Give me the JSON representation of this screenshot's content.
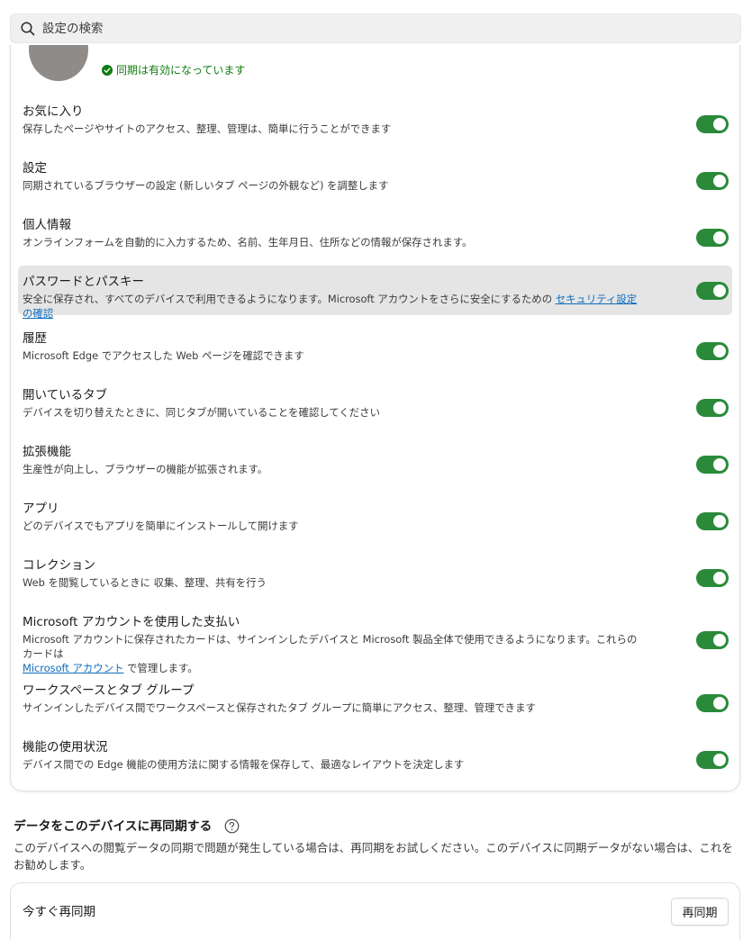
{
  "search": {
    "placeholder": "設定の検索"
  },
  "sync_status": {
    "text": "同期は有効になっています",
    "color": "#107c10"
  },
  "toggle_color": "#2a8a3a",
  "items": [
    {
      "title": "お気に入り",
      "desc": "保存したページやサイトのアクセス、整理、管理は、簡単に行うことができます",
      "enabled": true
    },
    {
      "title": "設定",
      "desc": "同期されているブラウザーの設定 (新しいタブ ページの外観など) を調整します",
      "enabled": true
    },
    {
      "title": "個人情報",
      "desc": "オンラインフォームを自動的に入力するため、名前、生年月日、住所などの情報が保存されます。",
      "enabled": true
    },
    {
      "title": "パスワードとパスキー",
      "desc": "安全に保存され、すべてのデバイスで利用できるようになります。Microsoft アカウントをさらに安全にするための",
      "link": "セキュリティ設定の確認",
      "enabled": true
    },
    {
      "title": "履歴",
      "desc": "Microsoft Edge でアクセスした Web ページを確認できます",
      "enabled": true
    },
    {
      "title": "開いているタブ",
      "desc": "デバイスを切り替えたときに、同じタブが開いていることを確認してください",
      "enabled": true
    },
    {
      "title": "拡張機能",
      "desc": "生産性が向上し、ブラウザーの機能が拡張されます。",
      "enabled": true
    },
    {
      "title": "アプリ",
      "desc": "どのデバイスでもアプリを簡単にインストールして開けます",
      "enabled": true
    },
    {
      "title": "コレクション",
      "desc": "Web を閲覧しているときに 収集、整理、共有を行う",
      "enabled": true
    },
    {
      "title": "Microsoft アカウントを使用した支払い",
      "desc": "Microsoft アカウントに保存されたカードは、サインインしたデバイスと Microsoft 製品全体で使用できるようになります。これらのカードは",
      "link": "Microsoft アカウント",
      "desc_suffix": " で管理します。",
      "enabled": true
    },
    {
      "title": "ワークスペースとタブ グループ",
      "desc": "サインインしたデバイス間でワークスペースと保存されたタブ グループに簡単にアクセス、整理、管理できます",
      "enabled": true
    },
    {
      "title": "機能の使用状況",
      "desc": "デバイス間での Edge 機能の使用方法に関する情報を保存して、最適なレイアウトを決定します",
      "enabled": true
    }
  ],
  "resync": {
    "heading": "データをこのデバイスに再同期する",
    "desc": "このデバイスへの閲覧データの同期で問題が発生している場合は、再同期をお試しください。このデバイスに同期データがない場合は、これをお勧めします。",
    "row_label": "今すぐ再同期",
    "button_label": "再同期"
  }
}
